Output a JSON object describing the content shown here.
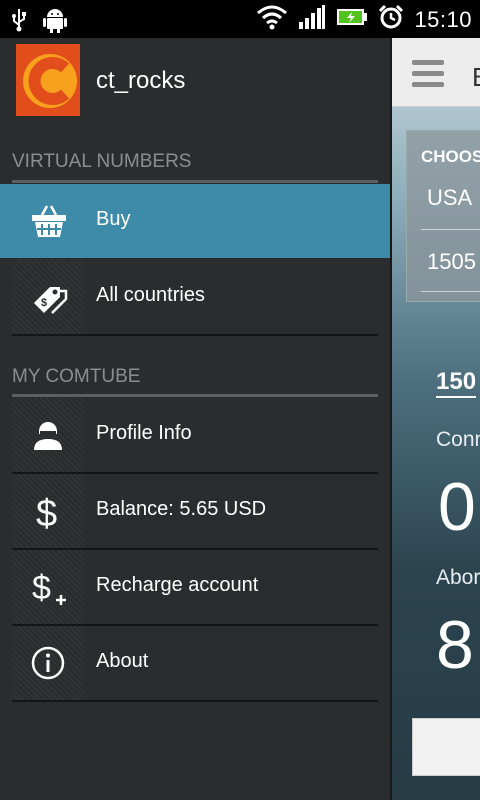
{
  "status_bar": {
    "time": "15:10",
    "icons": [
      "usb-icon",
      "android-icon",
      "wifi-icon",
      "signal-icon",
      "battery-charging-icon",
      "alarm-icon"
    ]
  },
  "drawer": {
    "username": "ct_rocks",
    "sections": [
      {
        "title": "VIRTUAL NUMBERS",
        "items": [
          {
            "label": "Buy",
            "icon": "basket-icon",
            "active": true
          },
          {
            "label": "All countries",
            "icon": "tags-icon",
            "active": false
          }
        ]
      },
      {
        "title": "MY COMTUBE",
        "items": [
          {
            "label": "Profile Info",
            "icon": "profile-icon",
            "active": false
          },
          {
            "label": "Balance: 5.65 USD",
            "icon": "dollar-icon",
            "active": false
          },
          {
            "label": "Recharge account",
            "icon": "dollar-plus-icon",
            "active": false
          },
          {
            "label": "About",
            "icon": "info-icon",
            "active": false
          }
        ]
      }
    ]
  },
  "background": {
    "title_partial": "B",
    "choose_partial": "CHOOS",
    "country_partial": "USA",
    "number_partial": "1505",
    "big_number_partial": "150",
    "connect_partial": "Conn",
    "value1_partial": "0",
    "about_partial": "Abor",
    "value2_partial": "8"
  },
  "colors": {
    "drawer_bg": "#2b2c2e",
    "active_item": "#3d8aa9",
    "section_text": "#8d8d8d",
    "logo_orange": "#e85a1f"
  }
}
